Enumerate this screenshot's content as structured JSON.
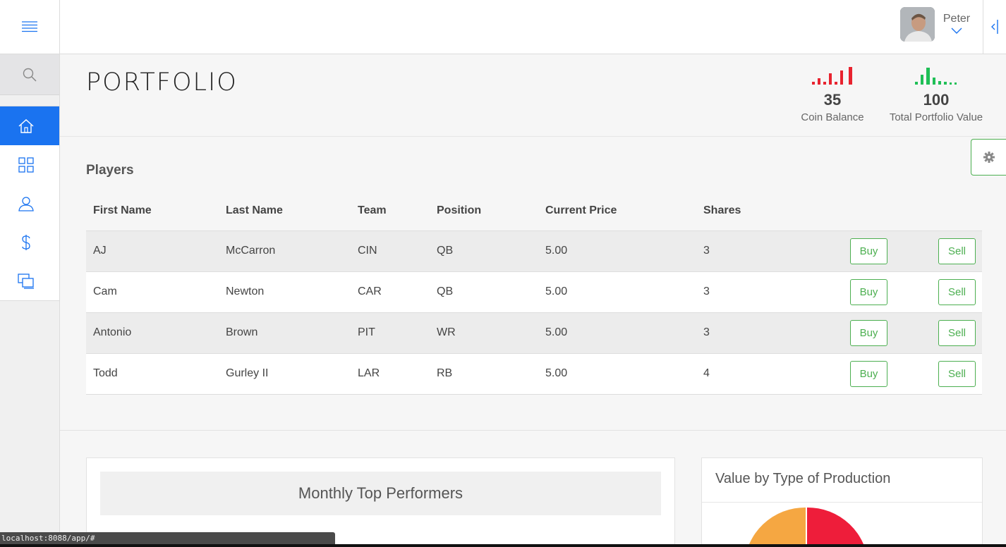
{
  "header": {
    "user_name": "Peter"
  },
  "page": {
    "title": "PORTFOLIO",
    "stats": {
      "coin_balance": {
        "value": "35",
        "label": "Coin Balance",
        "color": "#e8232f"
      },
      "total_value": {
        "value": "100",
        "label": "Total Portfolio Value",
        "color": "#1fbf56"
      }
    }
  },
  "sidebar": {
    "items": [
      {
        "icon": "home-icon",
        "active": true
      },
      {
        "icon": "grid-icon",
        "active": false
      },
      {
        "icon": "user-icon",
        "active": false
      },
      {
        "icon": "dollar-icon",
        "active": false
      },
      {
        "icon": "messages-icon",
        "active": false
      }
    ]
  },
  "players": {
    "title": "Players",
    "columns": [
      "First Name",
      "Last Name",
      "Team",
      "Position",
      "Current Price",
      "Shares"
    ],
    "buy_label": "Buy",
    "sell_label": "Sell",
    "rows": [
      {
        "first": "AJ",
        "last": "McCarron",
        "team": "CIN",
        "position": "QB",
        "price": "5.00",
        "shares": "3"
      },
      {
        "first": "Cam",
        "last": "Newton",
        "team": "CAR",
        "position": "QB",
        "price": "5.00",
        "shares": "3"
      },
      {
        "first": "Antonio",
        "last": "Brown",
        "team": "PIT",
        "position": "WR",
        "price": "5.00",
        "shares": "3"
      },
      {
        "first": "Todd",
        "last": "Gurley II",
        "team": "LAR",
        "position": "RB",
        "price": "5.00",
        "shares": "4"
      }
    ]
  },
  "cards": {
    "monthly_title": "Monthly Top Performers",
    "value_title": "Value by Type of Production"
  },
  "statusbar": {
    "url": "localhost:8088/app/#"
  },
  "colors": {
    "accent": "#1a73f0",
    "action_green": "#4caf50",
    "pie_orange": "#f5a742",
    "pie_red": "#ee1d3a"
  }
}
